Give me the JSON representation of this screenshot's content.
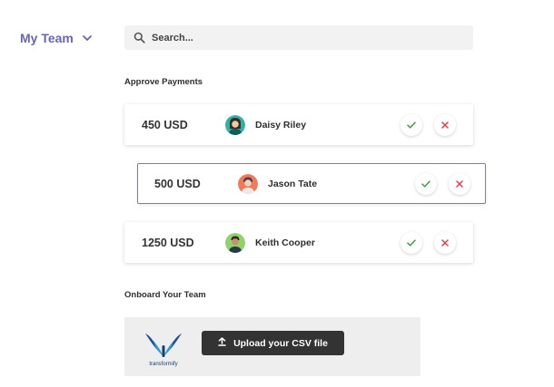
{
  "team_switcher": {
    "label": "My Team",
    "icon": "chevron-down-icon"
  },
  "search": {
    "placeholder": "Search...",
    "value": "",
    "icon": "search-icon"
  },
  "approve_section": {
    "title": "Approve Payments"
  },
  "payments": [
    {
      "amount": "450 USD",
      "name": "Daisy Riley",
      "selected": false,
      "avatar": "avatar-daisy"
    },
    {
      "amount": "500 USD",
      "name": "Jason Tate",
      "selected": true,
      "avatar": "avatar-jason"
    },
    {
      "amount": "1250 USD",
      "name": "Keith Cooper",
      "selected": false,
      "avatar": "avatar-keith"
    }
  ],
  "actions": {
    "approve_icon": "check-icon",
    "reject_icon": "close-icon"
  },
  "onboard_section": {
    "title": "Onboard Your Team",
    "logo_text": "transformify",
    "upload_label": "Upload your CSV file",
    "upload_icon": "upload-icon"
  },
  "colors": {
    "accent": "#6a64b8",
    "selected_border": "#7e79c6",
    "approve": "#3fa34d",
    "reject": "#e0404a",
    "upload_button": "#333333",
    "search_bg": "#f2f2f2",
    "onboard_bg": "#eeeeee"
  }
}
